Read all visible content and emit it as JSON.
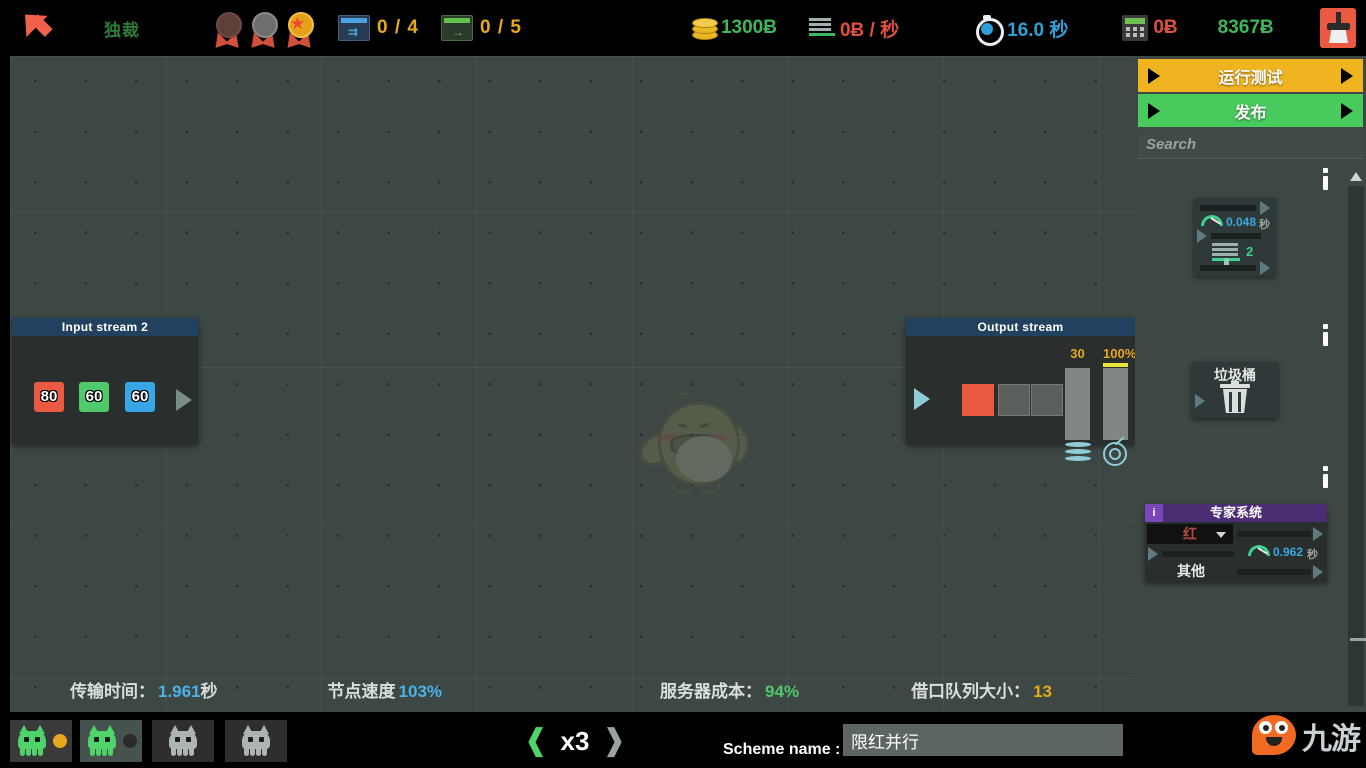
{
  "topbar": {
    "back_icon": "back-arrow-icon",
    "regime_label": "独裁",
    "medals": [
      {
        "name": "bronze-medal-icon",
        "color": "#5e3f3a"
      },
      {
        "name": "silver-medal-icon",
        "color": "#6e6e6e"
      },
      {
        "name": "gold-medal-icon",
        "color": "#e8a01c"
      }
    ],
    "counters": [
      {
        "icon": "blue-sheet-icon",
        "value": "0 / 4",
        "color": "#e8a81c"
      },
      {
        "icon": "green-sheet-icon",
        "value": "0 / 5",
        "color": "#e8a81c"
      }
    ],
    "money": {
      "icon": "coin-stack-icon",
      "value": "1300Ƀ",
      "color": "#3bb85a"
    },
    "rate": {
      "icon": "rate-lines-icon",
      "value": "0Ƀ / 秒",
      "color": "#e0503c"
    },
    "timer": {
      "icon": "stopwatch-icon",
      "value": "16.0 秒",
      "color": "#2f9fd8"
    },
    "cost": {
      "icon": "calculator-icon",
      "value": "0Ƀ",
      "color": "#e0503c"
    },
    "balance": {
      "value": "8367Ƀ",
      "color": "#3bb85a"
    },
    "sweep_button": "broom-icon"
  },
  "canvas": {
    "mascot": "bird-mascot-watermark",
    "input_node": {
      "title": "Input stream 2",
      "packets": [
        {
          "value": "80",
          "color": "#ea5a43"
        },
        {
          "value": "60",
          "color": "#4fc96a"
        },
        {
          "value": "60",
          "color": "#38a6e6"
        }
      ],
      "play": "play-icon"
    },
    "output_node": {
      "title": "Output stream",
      "play": "play-icon",
      "slots": [
        {
          "color": "#ea5a43",
          "filled": true
        },
        {
          "color": "#5a5e5d",
          "filled": false
        },
        {
          "color": "#5a5e5d",
          "filled": false
        }
      ],
      "gauges": [
        {
          "label": "30",
          "icon": "layers-icon",
          "fill_pct": 0
        },
        {
          "label": "100%",
          "icon": "target-icon",
          "fill_pct": 100
        }
      ]
    },
    "stats": [
      {
        "label": "传输时间：",
        "value": "1.961",
        "unit": "秒",
        "color": "#49b3ea"
      },
      {
        "label": "节点速度",
        "value": "103%",
        "unit": "",
        "color": "#49b3ea"
      },
      {
        "label": "服务器成本：",
        "value": "94%",
        "unit": "",
        "color": "#4fc96a"
      },
      {
        "label": "借口队列大小：",
        "value": "13",
        "unit": "",
        "color": "#e8a81c"
      }
    ]
  },
  "right_panel": {
    "run_button": "运行测试",
    "publish_button": "发布",
    "search_placeholder": "Search",
    "palette": [
      {
        "name": "processor-node",
        "time_value": "0.048",
        "time_unit": "秒",
        "thread_count": "2"
      },
      {
        "name": "trash-node",
        "title": "垃圾桶",
        "icon": "trash-bin-icon"
      },
      {
        "name": "expert-system-node",
        "title": "专家系统",
        "info_badge": "i",
        "dropdown_value": "红",
        "time_value": "0.962",
        "time_unit": "秒",
        "other_label": "其他"
      }
    ],
    "scroll_up_icon": "chevron-up-icon"
  },
  "bottombar": {
    "schemes": [
      {
        "name": "scheme-tab-1",
        "state": "active-gold",
        "cat_color": "#4fd36a",
        "dot": "#e8a81c"
      },
      {
        "name": "scheme-tab-2",
        "state": "selected",
        "cat_color": "#4fd36a",
        "dot": "#2b2b2b"
      },
      {
        "name": "scheme-tab-3",
        "state": "empty",
        "cat_color": "#adb4b4",
        "dot": null
      },
      {
        "name": "scheme-tab-4",
        "state": "empty",
        "cat_color": "#adb4b4",
        "dot": null
      }
    ],
    "speed_prev": "❰",
    "speed_value": "x3",
    "speed_next": "❱",
    "scheme_name_label": "Scheme name :",
    "scheme_name_value": "限红并行"
  },
  "watermark": {
    "logo": "jiuyou-blob-icon",
    "text": "九游"
  }
}
